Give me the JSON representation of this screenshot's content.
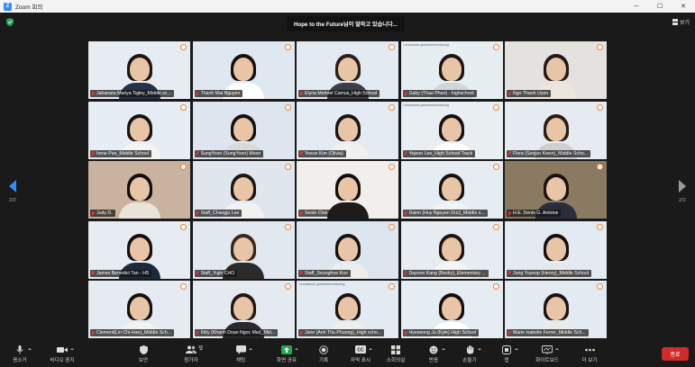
{
  "window": {
    "title": "Zoom 회의",
    "controls": [
      "minimize-icon",
      "maximize-icon",
      "close-icon"
    ]
  },
  "speaking": "Hope to the Future님이 말하고 있습니다...",
  "view_label": "보기",
  "page_indicator_left": "2/2",
  "page_indicator_right": "2/2",
  "participants": [
    {
      "name": "Jahanara Mariya Tigley_Middle sc...",
      "bg": "#e6ecf2",
      "shirt": "#26324a",
      "hair": "#1c1512",
      "banner": ""
    },
    {
      "name": "Thanh Mai Nguyen",
      "bg": "#dfe7f0",
      "shirt": "#ffffff",
      "hair": "#16100d",
      "banner": ""
    },
    {
      "name": "Elyna Mehriel Camus_High School",
      "bg": "#e3eaf2",
      "shirt": "#3a3f4a",
      "hair": "#2a1d16",
      "banner": ""
    },
    {
      "name": "Gaby (Thao Phan) - highschool",
      "bg": "#e7eef1",
      "shirt": "#cfd6dc",
      "hair": "#1b1411",
      "banner": "Lemissions globalnetmonitoring"
    },
    {
      "name": "Ngo Thanh Uyen",
      "bg": "#e4e2df",
      "shirt": "#ece6df",
      "hair": "#231813",
      "banner": ""
    },
    {
      "name": "Irene Pee_Middle School",
      "bg": "#e6edf4",
      "shirt": "#f3f3f3",
      "hair": "#1a1411",
      "banner": ""
    },
    {
      "name": "SungYoon (SungYoon) Moon",
      "bg": "#dde6ef",
      "shirt": "#d9d9d9",
      "hair": "#15110f",
      "banner": ""
    },
    {
      "name": "Yeeun Kim (Olivia)",
      "bg": "#e4ebf2",
      "shirt": "#f0f0f0",
      "hair": "#1b1411",
      "banner": ""
    },
    {
      "name": "Yejeon Lee_High School Track",
      "bg": "#e8eef2",
      "shirt": "#ffffff",
      "hair": "#14100e",
      "banner": "Lemissions globalnetmonitoring"
    },
    {
      "name": "Flora (Seojun Kwon)_Middle Scho...",
      "bg": "#e5ebf1",
      "shirt": "#cfcfd2",
      "hair": "#2a1c15",
      "banner": ""
    },
    {
      "name": "Judy D.",
      "bg": "#c9b39f",
      "shirt": "#e9e3da",
      "hair": "#120d0b",
      "banner": ""
    },
    {
      "name": "Staff_Changju Lee",
      "bg": "#dfe6ee",
      "shirt": "#f1f1f1",
      "hair": "#1c1613",
      "banner": ""
    },
    {
      "name": "Seoin Choi",
      "bg": "#f1efec",
      "shirt": "#1c1c1c",
      "hair": "#120e0c",
      "banner": ""
    },
    {
      "name": "Dainn (Huy Nguyen Duc)_Middle s...",
      "bg": "#e5ecf2",
      "shirt": "#f3f3f3",
      "hair": "#18120f",
      "banner": ""
    },
    {
      "name": "H.E. Denis G. Antoine",
      "bg": "#8a7a62",
      "shirt": "#2a2d3d",
      "hair": "#1b1310",
      "banner": ""
    },
    {
      "name": "James Benedict Tan - HS",
      "bg": "#e6ecf1",
      "shirt": "#1d2a3c",
      "hair": "#15100e",
      "banner": ""
    },
    {
      "name": "Staff_Yujin CHO",
      "bg": "#e2e8ef",
      "shirt": "#2b2b2b",
      "hair": "#3a271b",
      "banner": ""
    },
    {
      "name": "Staff_Seunghoe Koo",
      "bg": "#dde5ee",
      "shirt": "#ededed",
      "hair": "#15110f",
      "banner": ""
    },
    {
      "name": "Dayoon Kang (Becky)_Elementary ...",
      "bg": "#e6ecf2",
      "shirt": "#f5f5f5",
      "hair": "#1c1512",
      "banner": ""
    },
    {
      "name": "Jung Yuyeop (Henry)_Middle School",
      "bg": "#e3eaf1",
      "shirt": "#e8e8e8",
      "hair": "#14100e",
      "banner": ""
    },
    {
      "name": "Clement(Lin Chi-Han)_Middle Sch...",
      "bg": "#e5ebf1",
      "shirt": "#f2f2f2",
      "hair": "#15110f",
      "banner": ""
    },
    {
      "name": "Kitty (Khanh Doan Ngoc Mai)_Mid...",
      "bg": "#e4eaf0",
      "shirt": "#2a2a2e",
      "hair": "#231812",
      "banner": ""
    },
    {
      "name": "Jane (Anh Thu Phuong)_High scho...",
      "bg": "#e3eaf1",
      "shirt": "#eeeeee",
      "hair": "#1b1411",
      "banner": "Lemissions globalnetmonitoring"
    },
    {
      "name": "Hyeseong Ju (Kyle) High School",
      "bg": "#e5ecf2",
      "shirt": "#ffffff",
      "hair": "#120e0c",
      "banner": ""
    },
    {
      "name": "Marie Isabelle Ferrer_Middle Sch...",
      "bg": "#e4eaf1",
      "shirt": "#eaeaea",
      "hair": "#1a1310",
      "banner": ""
    }
  ],
  "toolbar": {
    "items": [
      {
        "label": "음소거",
        "icon": "mic-icon",
        "caret": true
      },
      {
        "label": "비디오 중지",
        "icon": "video-icon",
        "caret": true
      },
      {
        "label": "보안",
        "icon": "shield-icon",
        "caret": false
      },
      {
        "label": "참가자",
        "icon": "participants-icon",
        "caret": true,
        "count": "30"
      },
      {
        "label": "채팅",
        "icon": "chat-icon",
        "caret": true
      },
      {
        "label": "화면 공유",
        "icon": "share-screen-icon",
        "caret": true
      },
      {
        "label": "기록",
        "icon": "record-icon",
        "caret": false
      },
      {
        "label": "자막 표시",
        "icon": "cc-icon",
        "caret": true
      },
      {
        "label": "소회의실",
        "icon": "breakout-icon",
        "caret": false
      },
      {
        "label": "반응",
        "icon": "reaction-icon",
        "caret": true
      },
      {
        "label": "손들기",
        "icon": "raise-hand-icon",
        "caret": true
      },
      {
        "label": "앱",
        "icon": "apps-icon",
        "caret": true
      },
      {
        "label": "화이트보드",
        "icon": "whiteboard-icon",
        "caret": true
      },
      {
        "label": "더 보기",
        "icon": "more-icon",
        "caret": false
      }
    ],
    "end_label": "종료"
  },
  "colors": {
    "accent": "#2d8cff",
    "end": "#cf2b2b",
    "share": "#23a757",
    "muted_mic": "#e53935"
  }
}
